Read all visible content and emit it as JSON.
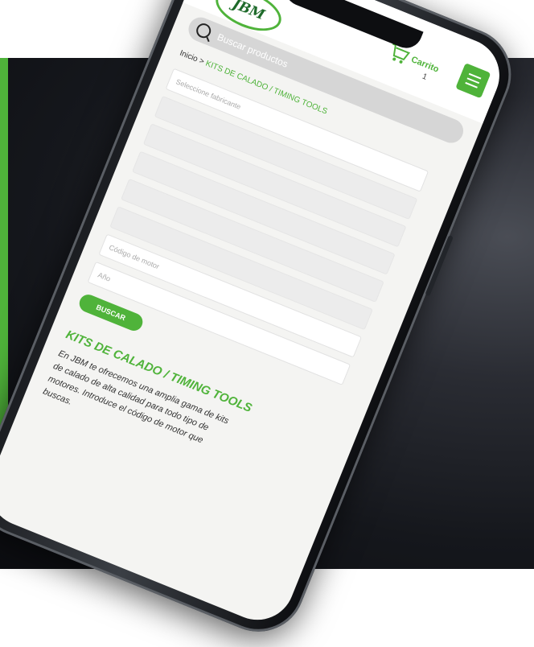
{
  "brand": {
    "logo_text": "JBM",
    "accent": "#4fb33a"
  },
  "header": {
    "cart_label": "Carrito",
    "cart_count": "1",
    "menu_icon": "hamburger-icon"
  },
  "search": {
    "placeholder": "Buscar productos"
  },
  "breadcrumb": {
    "home": "Inicio",
    "separator": ">",
    "current": "KITS DE CALADO / TIMING TOOLS"
  },
  "filters": {
    "fields": [
      {
        "placeholder": "Seleccione fabricante"
      },
      {
        "placeholder": ""
      },
      {
        "placeholder": ""
      },
      {
        "placeholder": ""
      },
      {
        "placeholder": ""
      },
      {
        "placeholder": ""
      },
      {
        "placeholder": "Código de motor"
      },
      {
        "placeholder": "Año"
      }
    ],
    "search_button": "Buscar"
  },
  "content": {
    "title": "KITS DE CALADO / TIMING TOOLS",
    "description": "En JBM te ofrecemos una amplia gama de kits de calado de alta calidad para todo tipo de motores. Introduce el código de motor que buscas."
  }
}
